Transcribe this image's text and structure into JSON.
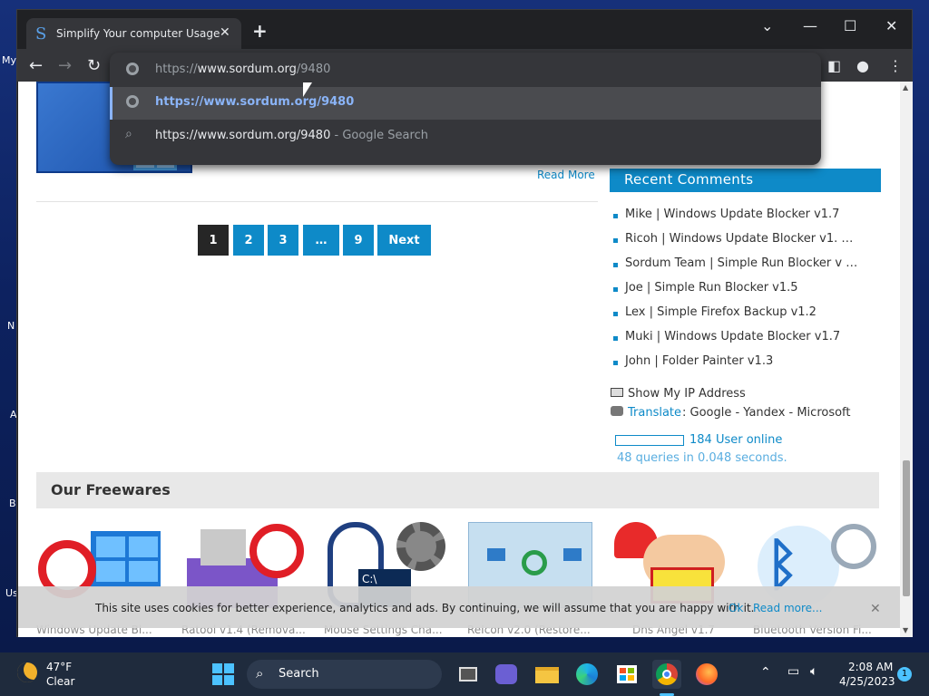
{
  "desktop": {
    "left_labels": [
      "My",
      "N",
      "A",
      "B",
      "Us"
    ]
  },
  "browser": {
    "tab": {
      "title": "Simplify Your computer Usage",
      "favicon": "S"
    },
    "window_controls": {
      "dropdown": "⌄",
      "minimize": "—",
      "maximize": "☐",
      "close": "✕"
    },
    "address": {
      "prefix": "https://",
      "host": "www.sordum.org",
      "path": "/9480"
    },
    "suggestions": [
      {
        "text": "https://www.sordum.org/9480",
        "suffix": ""
      },
      {
        "text": "https://www.sordum.org/9480",
        "suffix": " - Google Search"
      }
    ]
  },
  "page": {
    "read_more": "Read More",
    "pagination": [
      "1",
      "2",
      "3",
      "…",
      "9",
      "Next"
    ],
    "recent_comments": {
      "title": "Recent Comments",
      "items": [
        "Mike | Windows Update Blocker v1.7",
        "Ricoh | Windows Update Blocker v1. …",
        "Sordum Team | Simple Run Blocker v …",
        "Joe | Simple Run Blocker v1.5",
        "Lex | Simple Firefox Backup v1.2",
        "Muki | Windows Update Blocker v1.7",
        "John | Folder Painter v1.3"
      ]
    },
    "show_ip": "Show My IP Address",
    "translate": {
      "link": "Translate",
      "rest": " : Google - Yandex - Microsoft"
    },
    "users_online": "184 User online",
    "queries": "48 queries in 0.048 seconds.",
    "freewares": {
      "title": "Our Freewares",
      "items": [
        "Windows Update Bl...",
        "Ratool v1.4 (Remova...",
        "Mouse Settings Cha...",
        "ReIcon v2.0 (Restore...",
        "Dns Angel v1.7",
        "Bluetooth Version Fi..."
      ]
    },
    "cookie": {
      "text": "This site uses cookies for better experience, analytics and ads. By continuing, we will assume that you are happy with it.",
      "ok": "Ok",
      "read_more": "Read more...",
      "close": "✕"
    }
  },
  "taskbar": {
    "weather": {
      "temp": "47°F",
      "cond": "Clear"
    },
    "search": "Search",
    "clock": {
      "time": "2:08 AM",
      "date": "4/25/2023"
    },
    "notifications": "1"
  }
}
